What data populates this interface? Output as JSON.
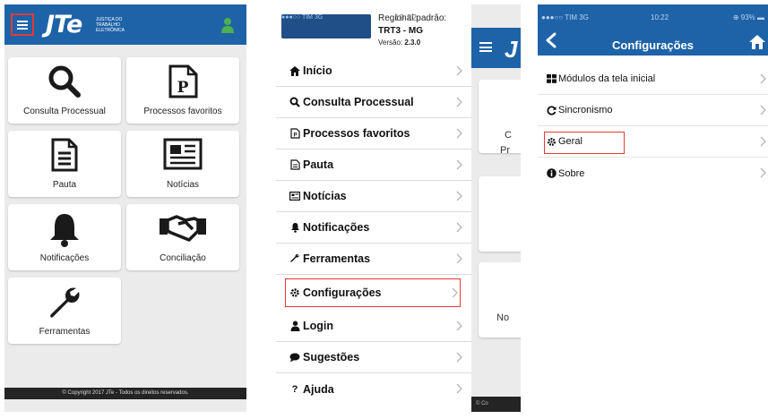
{
  "colors": {
    "header_blue": "#1e63a8",
    "highlight_red": "#e53935",
    "footer_dark": "#242424",
    "tile_icon": "#1a1a1a",
    "user_icon": "#4caf50"
  },
  "panel1": {
    "logo": "JTe",
    "logo_sub": "JUSTIÇA DO TRABALHO ELETRÔNICA",
    "icons": {
      "menu": "hamburger-menu-icon",
      "user": "user-icon"
    },
    "tiles": [
      {
        "label": "Consulta Processual",
        "icon": "search-icon"
      },
      {
        "label": "Processos favoritos",
        "icon": "document-p-icon"
      },
      {
        "label": "Pauta",
        "icon": "document-lines-icon"
      },
      {
        "label": "Notícias",
        "icon": "newspaper-icon"
      },
      {
        "label": "Notificações",
        "icon": "bell-icon"
      },
      {
        "label": "Conciliação",
        "icon": "handshake-icon"
      },
      {
        "label": "Ferramentas",
        "icon": "wrench-icon"
      }
    ],
    "footer": "© Copyright 2017 JTe - Todos os direitos reservados."
  },
  "panel2": {
    "status_ghost": "●●●○○ TIM  3G",
    "regional_label": "Regional padrão:",
    "regional_ghost": "10:22",
    "regional_name": "TRT3 - MG",
    "version_label": "Versão:",
    "version_value": "2.3.0",
    "menu_items": [
      {
        "label": "Início",
        "icon": "home-icon"
      },
      {
        "label": "Consulta Processual",
        "icon": "search-icon"
      },
      {
        "label": "Processos favoritos",
        "icon": "document-p-icon"
      },
      {
        "label": "Pauta",
        "icon": "document-lines-icon"
      },
      {
        "label": "Notícias",
        "icon": "newspaper-icon"
      },
      {
        "label": "Notificações",
        "icon": "bell-icon"
      },
      {
        "label": "Ferramentas",
        "icon": "wrench-icon"
      },
      {
        "label": "Configurações",
        "icon": "gear-icon",
        "highlighted": true
      },
      {
        "label": "Login",
        "icon": "user-icon"
      },
      {
        "label": "Sugestões",
        "icon": "speech-bubble-icon"
      },
      {
        "label": "Ajuda",
        "icon": "question-icon"
      }
    ],
    "background_app": {
      "tile_texts": [
        "C",
        "Pr",
        "No"
      ],
      "footer": "© Co"
    }
  },
  "panel3": {
    "status": {
      "carrier": "●●●○○ TIM  3G",
      "time": "10:22",
      "battery": "⊕ 93% ▬"
    },
    "title": "Configurações",
    "icons": {
      "back": "back-arrow-icon",
      "home": "home-icon"
    },
    "items": [
      {
        "label": "Módulos da tela inicial",
        "icon": "grid-icon"
      },
      {
        "label": "Sincronismo",
        "icon": "sync-icon"
      },
      {
        "label": "Geral",
        "icon": "gear-icon",
        "highlighted": true
      },
      {
        "label": "Sobre",
        "icon": "info-icon"
      }
    ]
  }
}
